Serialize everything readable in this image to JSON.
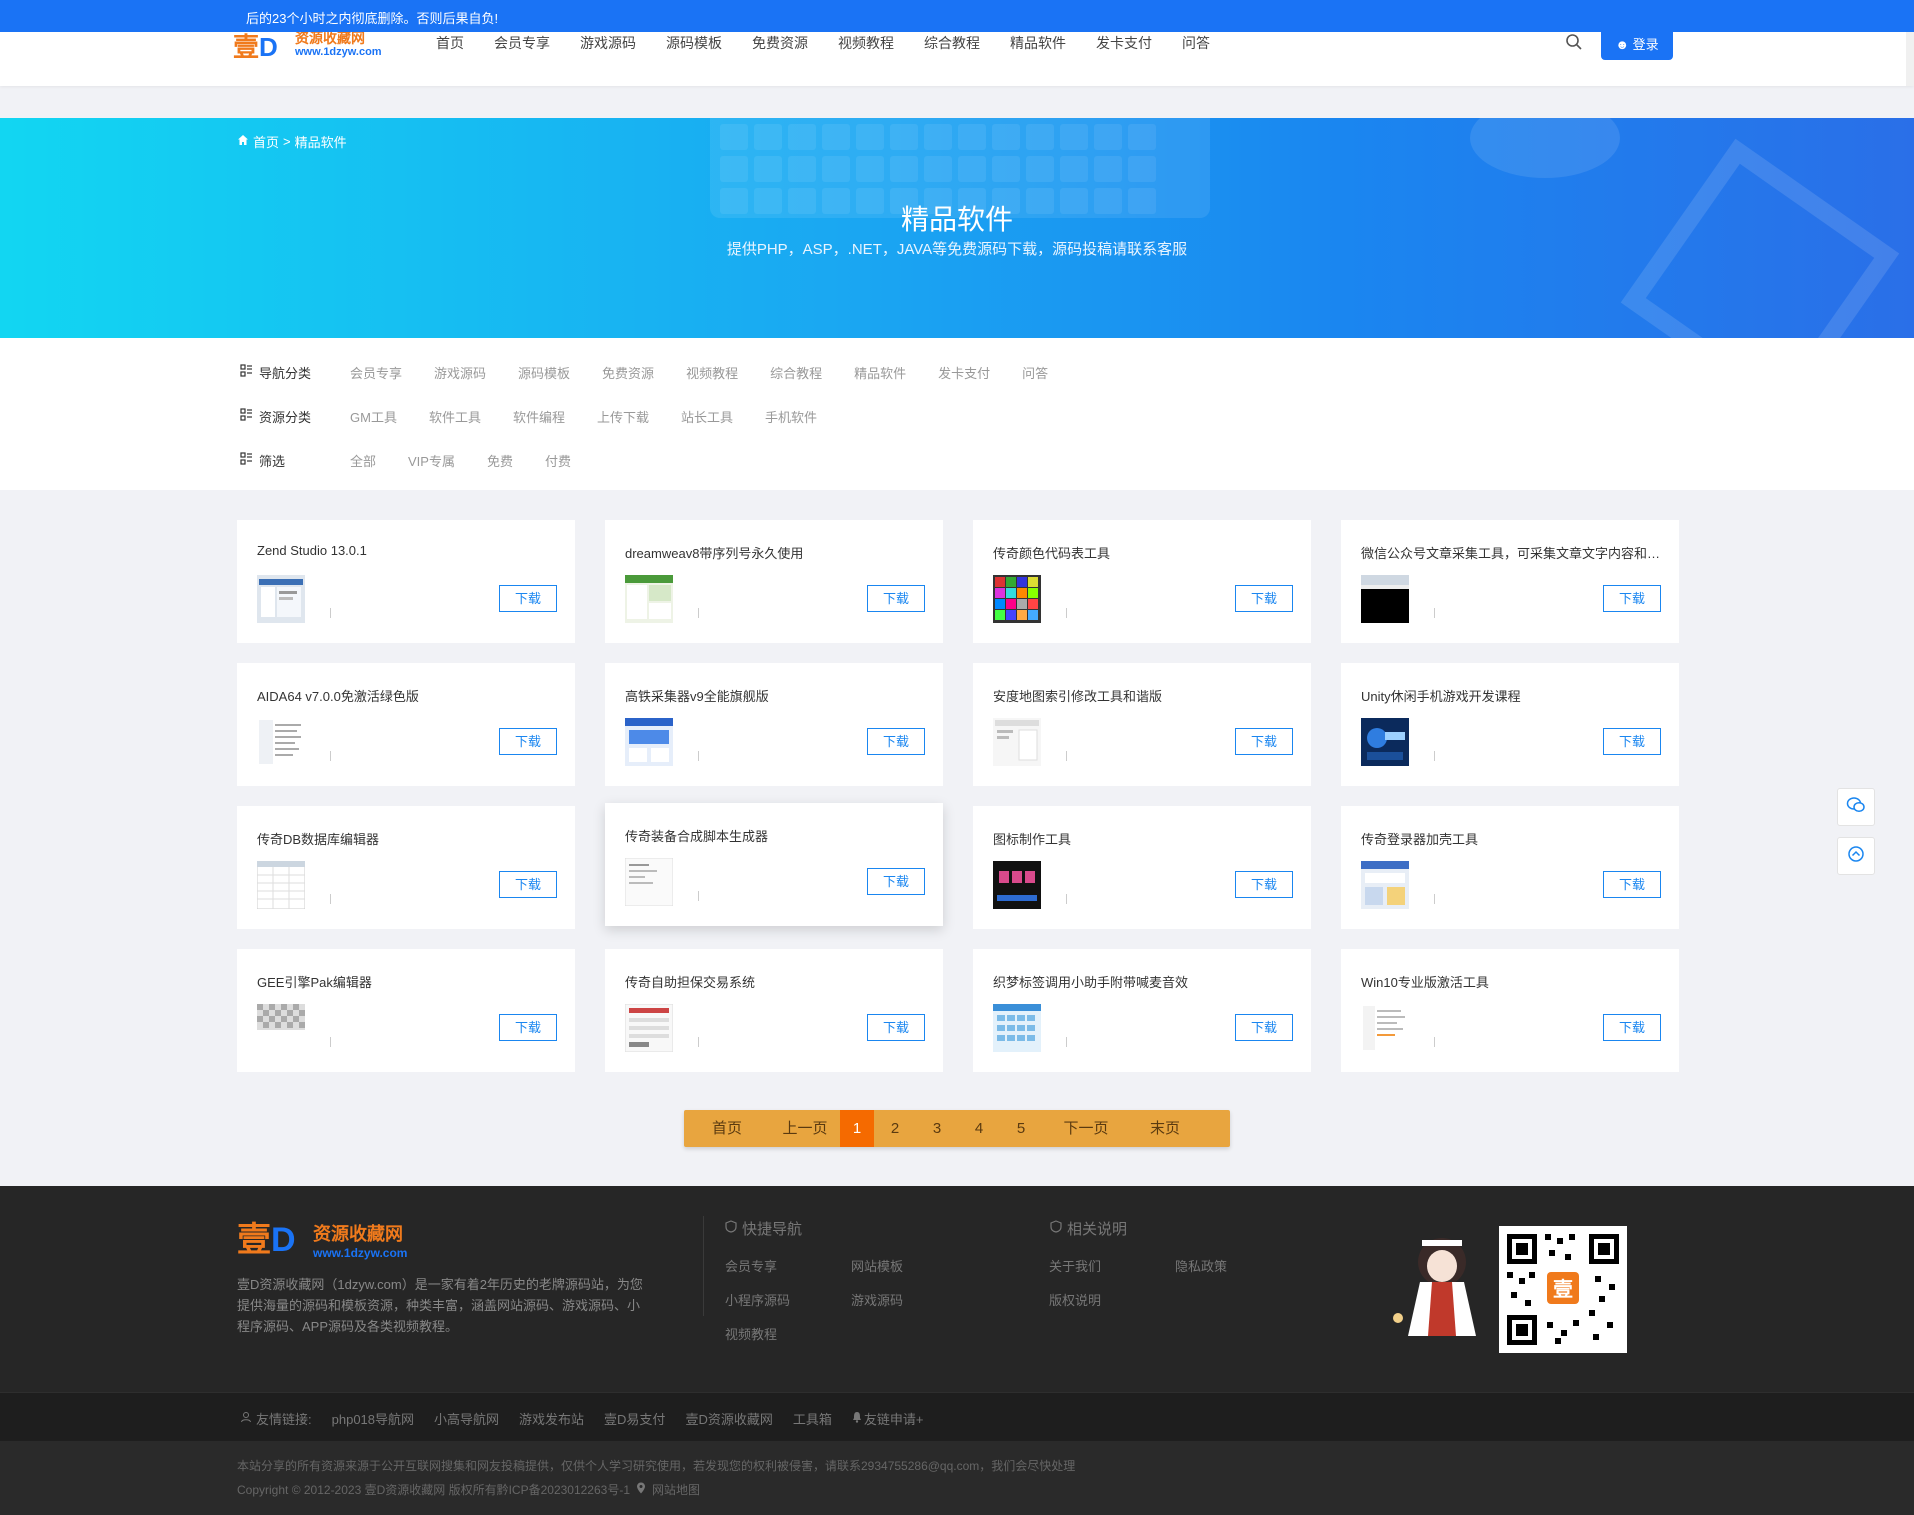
{
  "notice": "后的23个小时之内彻底删除。否则后果自负!",
  "header": {
    "logo_mark": "壹D",
    "logo_text": "资源收藏网",
    "logo_url": "www.1dzyw.com",
    "nav": [
      "首页",
      "会员专享",
      "游戏源码",
      "源码模板",
      "免费资源",
      "视频教程",
      "综合教程",
      "精品软件",
      "发卡支付",
      "问答"
    ],
    "login_label": "登录"
  },
  "hero": {
    "breadcrumb_home": "首页",
    "breadcrumb_sep": ">",
    "breadcrumb_current": "精品软件",
    "title": "精品软件",
    "subtitle": "提供PHP，ASP，.NET，JAVA等免费源码下载，源码投稿请联系客服"
  },
  "filters": {
    "nav_label": "导航分类",
    "nav_items": [
      "会员专享",
      "游戏源码",
      "源码模板",
      "免费资源",
      "视频教程",
      "综合教程",
      "精品软件",
      "发卡支付",
      "问答"
    ],
    "res_label": "资源分类",
    "res_items": [
      "GM工具",
      "软件工具",
      "软件编程",
      "上传下载",
      "站长工具",
      "手机软件"
    ],
    "screen_label": "筛选",
    "screen_items": [
      "全部",
      "VIP专属",
      "免费",
      "付费"
    ]
  },
  "cards": [
    {
      "title": "Zend Studio 13.0.1",
      "thumb": "window-screenshot"
    },
    {
      "title": "dreamweav8带序列号永久使用",
      "thumb": "green-app-screenshot"
    },
    {
      "title": "传奇颜色代码表工具",
      "thumb": "color-grid"
    },
    {
      "title": "微信公众号文章采集工具，可采集文章文字内容和图片",
      "thumb": "black-window"
    },
    {
      "title": "AIDA64 v7.0.0免激活绿色版",
      "thumb": "list-window"
    },
    {
      "title": "高铁采集器v9全能旗舰版",
      "thumb": "blue-app"
    },
    {
      "title": "安度地图索引修改工具和谐版",
      "thumb": "white-window"
    },
    {
      "title": "Unity休闲手机游戏开发课程",
      "thumb": "game-art"
    },
    {
      "title": "传奇DB数据库编辑器",
      "thumb": "table-window"
    },
    {
      "title": "传奇装备合成脚本生成器",
      "thumb": "text-window"
    },
    {
      "title": "图标制作工具",
      "thumb": "icon-maker"
    },
    {
      "title": "传奇登录器加壳工具",
      "thumb": "dialog-window"
    },
    {
      "title": "GEE引擎Pak编辑器",
      "thumb": "checker-pattern"
    },
    {
      "title": "传奇自助担保交易系统",
      "thumb": "form-window"
    },
    {
      "title": "织梦标签调用小助手附带喊麦音效",
      "thumb": "blue-grid"
    },
    {
      "title": "Win10专业版激活工具",
      "thumb": "file-window"
    }
  ],
  "download_label": "下载",
  "pager": {
    "first": "首页",
    "prev": "上一页",
    "pages": [
      "1",
      "2",
      "3",
      "4",
      "5"
    ],
    "current": "1",
    "next": "下一页",
    "last": "末页"
  },
  "footer": {
    "logo_mark": "壹D",
    "logo_text": "资源收藏网",
    "logo_url": "www.1dzyw.com",
    "desc": "壹D资源收藏网（1dzyw.com）是一家有着2年历史的老牌源码站，为您提供海量的源码和模板资源，种类丰富，涵盖网站源码、游戏源码、小程序源码、APP源码及各类视频教程。",
    "quick_title": "快捷导航",
    "quick_links": [
      "会员专享",
      "网站模板",
      "小程序源码",
      "游戏源码",
      "视频教程"
    ],
    "about_title": "相关说明",
    "about_links": [
      "关于我们",
      "隐私政策",
      "版权说明"
    ]
  },
  "friends": {
    "label": "友情链接:",
    "links": [
      "php018导航网",
      "小高导航网",
      "游戏发布站",
      "壹D易支付",
      "壹D资源收藏网",
      "工具箱"
    ],
    "apply": "友链申请+"
  },
  "copyright": {
    "line1": "本站分享的所有资源来源于公开互联网搜集和网友投稿提供，仅供个人学习研究使用，若发现您的权利被侵害，请联系2934755286@qq.com，我们会尽快处理",
    "line2": "Copyright © 2012-2023 壹D资源收藏网 版权所有黔ICP备2023012263号-1",
    "sitemap": "网站地图"
  },
  "colors": {
    "brand_blue": "#1a73f5",
    "brand_orange": "#f07a1c",
    "pager_bg": "#e8a53f",
    "pager_active": "#f56a00"
  }
}
